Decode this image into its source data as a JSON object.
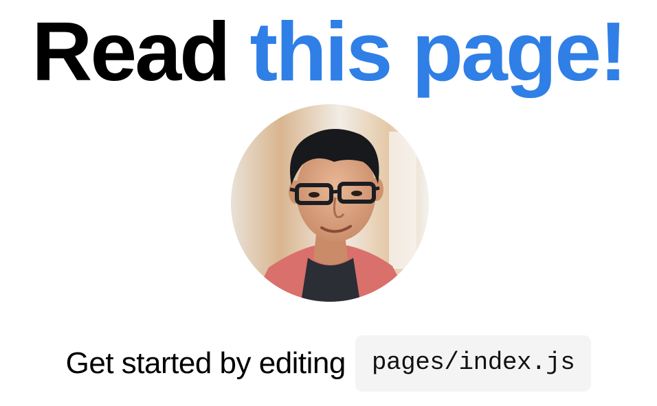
{
  "title": {
    "prefix": "Read",
    "link_text": "this page!"
  },
  "avatar": {
    "kind": "profile-photo"
  },
  "description": {
    "text": "Get started by editing",
    "code": "pages/index.js"
  },
  "colors": {
    "accent": "#2f7fe6",
    "text": "#000000",
    "code_background": "#f4f4f4",
    "page_background": "#ffffff"
  }
}
